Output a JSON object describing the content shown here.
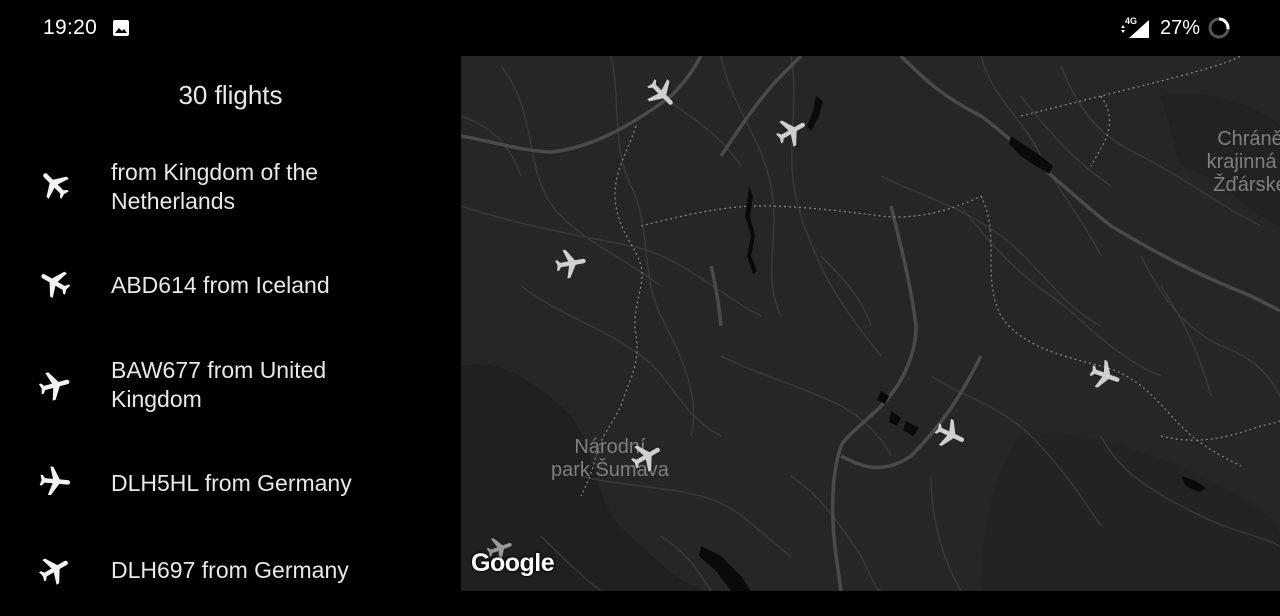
{
  "status_bar": {
    "time": "19:20",
    "network": "4G",
    "battery": "27%",
    "icons": [
      "gallery-icon",
      "signal-icon",
      "battery-icon"
    ]
  },
  "flight_list": {
    "title": "30 flights",
    "items": [
      {
        "label": " from Kingdom of the Netherlands",
        "icon": "airplane-icon"
      },
      {
        "label": "ABD614 from Iceland",
        "icon": "airplane-icon"
      },
      {
        "label": "BAW677 from United Kingdom",
        "icon": "airplane-icon"
      },
      {
        "label": "DLH5HL from Germany",
        "icon": "airplane-icon"
      },
      {
        "label": "DLH697 from Germany",
        "icon": "airplane-icon"
      }
    ]
  },
  "map": {
    "labels": {
      "park_line1": "Národní",
      "park_line2": "park Šumava",
      "chko_line1": "Chráně",
      "chko_line2": "krajinná o",
      "chko_line3": "Žďárské"
    },
    "attribution": "Google",
    "marker_icon": "airplane-icon",
    "colors": {
      "background": "#262626",
      "road": "#3c3c3c",
      "highway": "#4a4a4a",
      "border": "#8a8a8a",
      "label": "#7f7f7f",
      "marker": "#cfcfcf"
    }
  }
}
